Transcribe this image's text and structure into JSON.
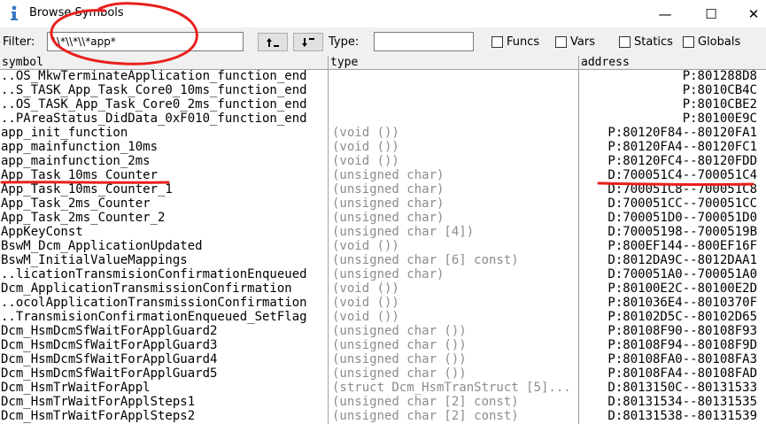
{
  "window": {
    "title": "Browse Symbols",
    "minimize": "—",
    "maximize": "☐",
    "close": "✕"
  },
  "toolbar": {
    "filter_label": "Filter:",
    "filter_value": "\\\\*\\\\*\\\\*app*",
    "type_label": "Type:",
    "type_value": "",
    "checkboxes": [
      {
        "label": "Funcs",
        "checked": false
      },
      {
        "label": "Vars",
        "checked": false
      },
      {
        "label": "Statics",
        "checked": false
      },
      {
        "label": "Globals",
        "checked": false
      }
    ]
  },
  "table": {
    "columns": [
      "symbol",
      "type",
      "address"
    ],
    "rows": [
      {
        "symbol": "..OS_MkwTerminateApplication_function_end",
        "type": "",
        "address": "P:801288D8"
      },
      {
        "symbol": "..S_TASK_App_Task_Core0_10ms_function_end",
        "type": "",
        "address": "P:8010CB4C"
      },
      {
        "symbol": "..OS_TASK_App_Task_Core0_2ms_function_end",
        "type": "",
        "address": "P:8010CBE2"
      },
      {
        "symbol": "..PAreaStatus_DidData_0xF010_function_end",
        "type": "",
        "address": "P:80100E9C"
      },
      {
        "symbol": "app_init_function",
        "type": "(void ())",
        "address": "P:80120F84--80120FA1"
      },
      {
        "symbol": "app_mainfunction_10ms",
        "type": "(void ())",
        "address": "P:80120FA4--80120FC1"
      },
      {
        "symbol": "app_mainfunction_2ms",
        "type": "(void ())",
        "address": "P:80120FC4--80120FDD"
      },
      {
        "symbol": "App_Task_10ms_Counter",
        "type": "(unsigned char)",
        "address": "D:700051C4--700051C4"
      },
      {
        "symbol": "App_Task_10ms_Counter_1",
        "type": "(unsigned char)",
        "address": "D:700051C8--700051C8"
      },
      {
        "symbol": "App_Task_2ms_Counter",
        "type": "(unsigned char)",
        "address": "D:700051CC--700051CC"
      },
      {
        "symbol": "App_Task_2ms_Counter_2",
        "type": "(unsigned char)",
        "address": "D:700051D0--700051D0"
      },
      {
        "symbol": "AppKeyConst",
        "type": "(unsigned char [4])",
        "address": "D:70005198--7000519B"
      },
      {
        "symbol": "BswM_Dcm_ApplicationUpdated",
        "type": "(void ())",
        "address": "P:800EF144--800EF16F"
      },
      {
        "symbol": "BswM_InitialValueMappings",
        "type": "(unsigned char [6] const)",
        "address": "D:8012DA9C--8012DAA1"
      },
      {
        "symbol": "..licationTransmisionConfirmationEnqueued",
        "type": "(unsigned char)",
        "address": "D:700051A0--700051A0"
      },
      {
        "symbol": "Dcm_ApplicationTransmissionConfirmation",
        "type": "(void ())",
        "address": "P:80100E2C--80100E2D"
      },
      {
        "symbol": "..ocolApplicationTransmissionConfirmation",
        "type": "(void ())",
        "address": "P:801036E4--8010370F"
      },
      {
        "symbol": "..TransmisionConfirmationEnqueued_SetFlag",
        "type": "(void ())",
        "address": "P:80102D5C--80102D65"
      },
      {
        "symbol": "Dcm_HsmDcmSfWaitForApplGuard2",
        "type": "(unsigned char ())",
        "address": "P:80108F90--80108F93"
      },
      {
        "symbol": "Dcm_HsmDcmSfWaitForApplGuard3",
        "type": "(unsigned char ())",
        "address": "P:80108F94--80108F9D"
      },
      {
        "symbol": "Dcm_HsmDcmSfWaitForApplGuard4",
        "type": "(unsigned char ())",
        "address": "P:80108FA0--80108FA3"
      },
      {
        "symbol": "Dcm_HsmDcmSfWaitForApplGuard5",
        "type": "(unsigned char ())",
        "address": "P:80108FA4--80108FAD"
      },
      {
        "symbol": "Dcm_HsmTrWaitForAppl",
        "type": "(struct Dcm_HsmTranStruct [5]...",
        "address": "D:8013150C--80131533"
      },
      {
        "symbol": "Dcm_HsmTrWaitForApplSteps1",
        "type": "(unsigned char [2] const)",
        "address": "D:80131534--80131535"
      },
      {
        "symbol": "Dcm_HsmTrWaitForApplSteps2",
        "type": "(unsigned char [2] const)",
        "address": "D:80131538--80131539"
      }
    ]
  },
  "colors": {
    "annotation": "#e8201c",
    "type_text": "#8c8c8c",
    "toolbar_bg": "#f0f0f0"
  }
}
